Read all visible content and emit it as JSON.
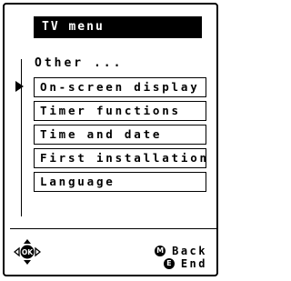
{
  "title": "TV menu",
  "section_label": "Other ...",
  "menu_items": [
    {
      "label": "On-screen display",
      "selected": true
    },
    {
      "label": "Timer functions",
      "selected": false
    },
    {
      "label": "Time and date",
      "selected": false
    },
    {
      "label": "First installation",
      "selected": false
    },
    {
      "label": "Language",
      "selected": false
    }
  ],
  "navigation": {
    "ok_label": "OK",
    "icon": "ok-direction-pad-icon"
  },
  "legend": [
    {
      "key": "M",
      "label": "Back",
      "icon": "m-key-icon"
    },
    {
      "key": "E",
      "label": "End",
      "icon": "e-key-icon"
    }
  ],
  "colors": {
    "foreground": "#000000",
    "background": "#ffffff"
  }
}
